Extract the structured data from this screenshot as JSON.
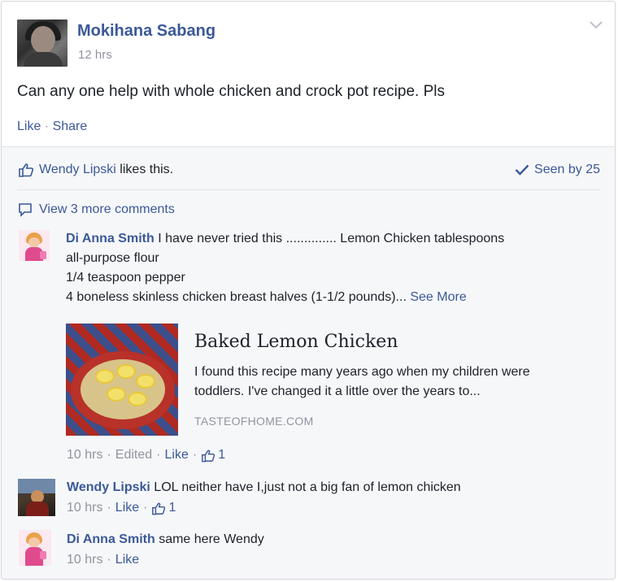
{
  "post": {
    "author": "Mokihana Sabang",
    "time": "12 hrs",
    "text": "Can any one help with whole chicken and crock pot recipe. Pls",
    "actions": {
      "like": "Like",
      "sep": " · ",
      "share": "Share"
    }
  },
  "likes": {
    "name": "Wendy Lipski",
    "suffix": " likes this."
  },
  "seen": {
    "label": "Seen by 25"
  },
  "view_more": {
    "label": "View 3 more comments"
  },
  "comments": [
    {
      "author": "Di Anna Smith",
      "line1": " I have never tried this .............. Lemon Chicken tablespoons",
      "line2": "all-purpose flour",
      "line3": "1/4 teaspoon pepper",
      "line4": "4 boneless skinless chicken breast halves (1-1/2 pounds)...",
      "see_more": "See More",
      "meta": {
        "time": "10 hrs",
        "edited": "Edited",
        "like": "Like",
        "like_count": "1"
      },
      "link_preview": {
        "title": "Baked Lemon Chicken",
        "description": "I found this recipe many years ago when my children were toddlers. I've changed it a little over the years to...",
        "domain": "TASTEOFHOME.COM"
      }
    },
    {
      "author": "Wendy Lipski",
      "text": " LOL neither have I,just not a big fan of lemon chicken",
      "meta": {
        "time": "10 hrs",
        "like": "Like",
        "like_count": "1"
      }
    },
    {
      "author": "Di Anna Smith",
      "text": " same here Wendy",
      "meta": {
        "time": "10 hrs",
        "like": "Like"
      }
    }
  ],
  "colors": {
    "link": "#3b5998",
    "muted": "#90949c",
    "panel": "#f6f7f9"
  },
  "icons": [
    "chevron-down-icon",
    "thumbs-up-icon",
    "checkmark-icon",
    "comment-bubble-icon"
  ]
}
